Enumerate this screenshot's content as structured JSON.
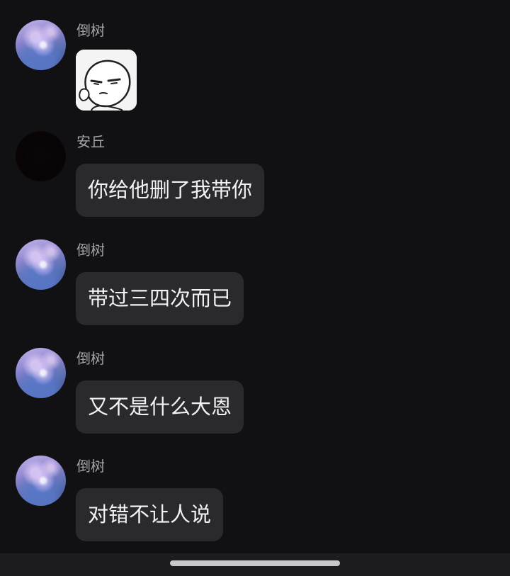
{
  "messages": [
    {
      "sender": "倒树",
      "type": "sticker",
      "sticker_name": "meme-face-sticker"
    },
    {
      "sender": "安丘",
      "type": "text",
      "text": "你给他删了我带你"
    },
    {
      "sender": "倒树",
      "type": "text",
      "text": "带过三四次而已"
    },
    {
      "sender": "倒树",
      "type": "text",
      "text": "又不是什么大恩"
    },
    {
      "sender": "倒树",
      "type": "text",
      "text": "对错不让人说"
    }
  ],
  "colors": {
    "background": "#111114",
    "bubble": "#2a2a2e",
    "bubble_text": "#f2f2f4",
    "sender_text": "#a3a3aa",
    "bottom_bar": "#1c1c1e",
    "home_indicator": "#c8c8cc"
  }
}
